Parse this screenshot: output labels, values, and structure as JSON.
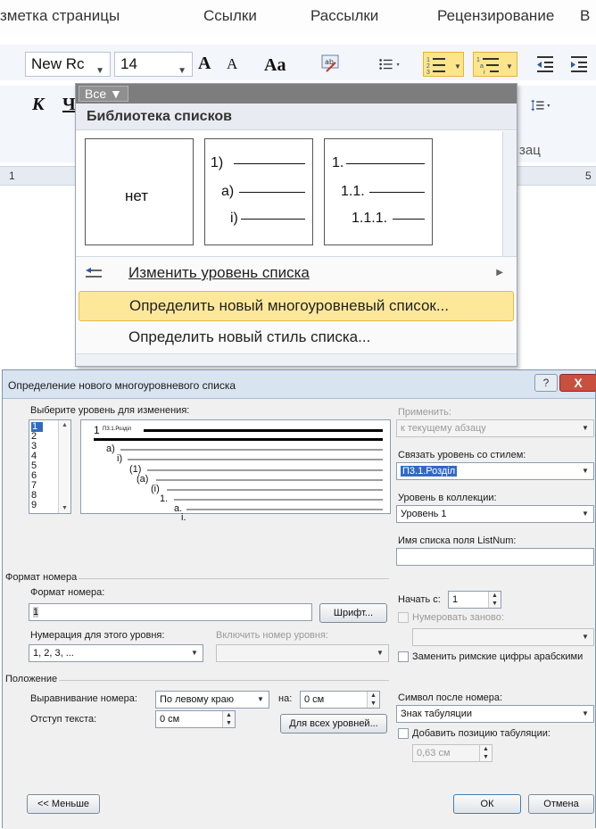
{
  "ribbon": {
    "tabs": [
      "зметка страницы",
      "Ссылки",
      "Рассылки",
      "Рецензирование",
      "В"
    ],
    "font_name": "New Rc",
    "font_size": "14",
    "grow_font": "A",
    "shrink_font": "A",
    "case_btn": "Aa",
    "italic": "К",
    "underline": "Ч",
    "group_label": "зац",
    "ruler_left": "1",
    "ruler_right": "5"
  },
  "menu": {
    "filter_label": "Все ▼",
    "section_title": "Библиотека списков",
    "items": [
      {
        "type": "none",
        "label": "нет"
      },
      {
        "type": "numbered",
        "lines": [
          "1)",
          "a)",
          "i)"
        ]
      },
      {
        "type": "numbered",
        "lines": [
          "1.",
          "1.1.",
          "1.1.1."
        ]
      }
    ],
    "change_level": "Изменить уровень списка",
    "define_multilevel": "Определить новый многоуровневый список...",
    "define_style": "Определить новый стиль списка..."
  },
  "dialog": {
    "title": "Определение нового многоуровневого списка",
    "help": "?",
    "close": "X",
    "choose_level_label": "Выберите уровень для изменения:",
    "levels": [
      "1",
      "2",
      "3",
      "4",
      "5",
      "6",
      "7",
      "8",
      "9"
    ],
    "selected_level": "1",
    "preview": {
      "lines": [
        "1",
        "П3.1.Розділ",
        "a)",
        "i)",
        "(1)",
        "(a)",
        "(i)",
        "1.",
        "a.",
        "i."
      ]
    },
    "apply_label": "Применить:",
    "apply_value": "к текущему абзацу",
    "link_style_label": "Связать уровень со стилем:",
    "link_style_value": "П3.1.Розділ",
    "gallery_level_label": "Уровень в коллекции:",
    "gallery_level_value": "Уровень 1",
    "listnum_label": "Имя списка поля ListNum:",
    "listnum_value": "",
    "number_format_group": "Формат номера",
    "number_format_label": "Формат номера:",
    "number_format_value": "1",
    "font_button": "Шрифт...",
    "start_at_label": "Начать с:",
    "start_at_value": "1",
    "restart_label": "Нумеровать заново:",
    "numbering_style_label": "Нумерация для этого уровня:",
    "numbering_style_value": "1, 2, 3, ...",
    "include_level_label": "Включить номер уровня:",
    "legal_numbering_label": "Заменить римские цифры арабскими",
    "position_group": "Положение",
    "alignment_label": "Выравнивание номера:",
    "alignment_value": "По левому краю",
    "at_label": "на:",
    "at_value": "0 см",
    "text_indent_label": "Отступ текста:",
    "text_indent_value": "0 см",
    "all_levels_button": "Для всех уровней...",
    "follow_number_label": "Символ после номера:",
    "follow_number_value": "Знак табуляции",
    "add_tab_label": "Добавить позицию табуляции:",
    "tab_value": "0,63 см",
    "less_button": "<< Меньше",
    "ok_button": "ОК",
    "cancel_button": "Отмена"
  },
  "colors": {
    "highlight": "#fde89a",
    "selection": "#316ac5"
  }
}
